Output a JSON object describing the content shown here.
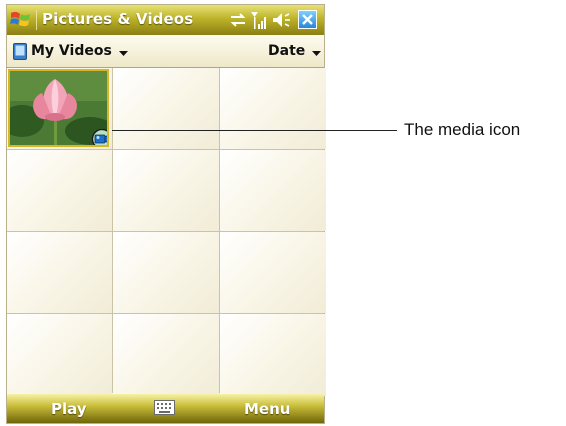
{
  "window": {
    "title": "Pictures & Videos",
    "logo_icon": "windows-flag-icon",
    "status_icons": [
      "sync-icon",
      "signal-icon",
      "speaker-icon"
    ],
    "close_icon": "close-x-icon"
  },
  "subheader": {
    "folder_icon": "mobile-device-icon",
    "folder_label": "My Videos",
    "sort_label": "Date"
  },
  "grid": {
    "columns": 3,
    "rows": 4,
    "items": [
      {
        "type": "video-thumbnail",
        "subject": "lotus flower",
        "overlay_icon": "video-camera-icon"
      }
    ]
  },
  "softkeys": {
    "left": "Play",
    "center_icon": "keyboard-icon",
    "right": "Menu"
  },
  "annotation": {
    "text": "The media icon"
  },
  "colors": {
    "title_bar": "#bdb32a",
    "selection_border": "#d8b727",
    "grid_bg": "#f7f1de"
  }
}
